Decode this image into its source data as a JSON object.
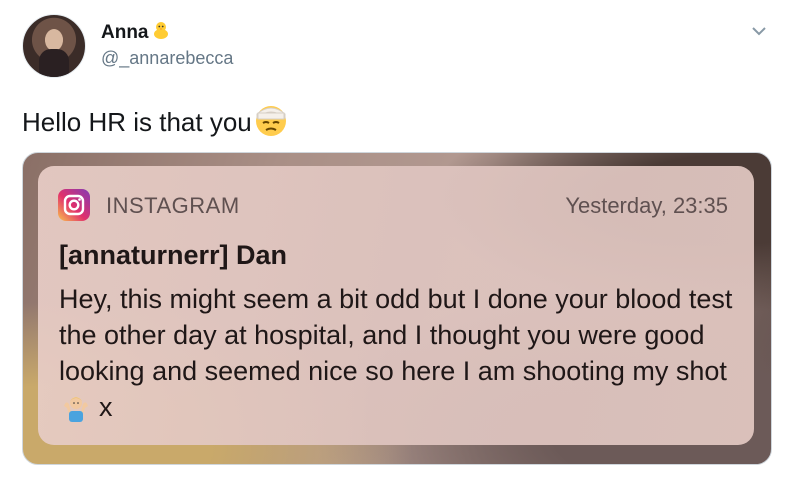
{
  "tweet": {
    "display_name": "Anna",
    "handle": "@_annarebecca",
    "text": "Hello HR is that you",
    "display_name_emoji": "baby-chick-icon",
    "text_emoji": "bandaged-face-icon",
    "menu_icon": "chevron-down-icon"
  },
  "notification": {
    "app_name": "INSTAGRAM",
    "time": "Yesterday, 23:35",
    "sender": "[annaturnerr] Dan",
    "message_part1": "Hey, this might seem a bit odd but I done your blood test the other day at hospital, and I thought you were good looking and seemed nice so here I am shooting my shot",
    "message_part2": "x",
    "app_icon": "instagram-icon",
    "message_emoji": "person-shrugging-icon"
  }
}
